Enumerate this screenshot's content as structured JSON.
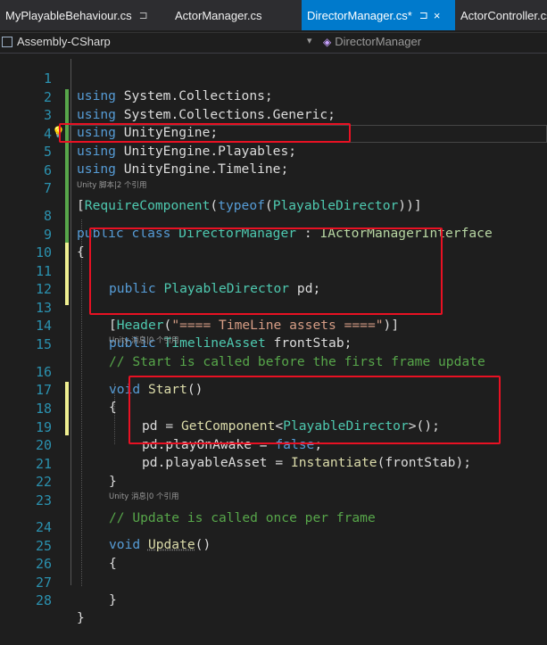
{
  "tabs": [
    {
      "label": "MyPlayableBehaviour.cs",
      "pin": "⊐"
    },
    {
      "label": "ActorManager.cs"
    },
    {
      "label": "DirectorManager.cs*",
      "pin": "⊐",
      "close": "×"
    },
    {
      "label": "ActorController.cs"
    }
  ],
  "navbar": {
    "project": "Assembly-CSharp",
    "dropdown": "▾",
    "class_name": "DirectorManager"
  },
  "lines": {
    "n1": "1",
    "n2": "2",
    "n3": "3",
    "n4": "4",
    "n5": "5",
    "n6": "6",
    "n7": "7",
    "n8": "8",
    "n9": "9",
    "n10": "10",
    "n11": "11",
    "n12": "12",
    "n13": "13",
    "n14": "14",
    "n15": "15",
    "n16": "16",
    "n17": "17",
    "n18": "18",
    "n19": "19",
    "n20": "20",
    "n21": "21",
    "n22": "22",
    "n23": "23",
    "n24": "24",
    "n25": "25",
    "n26": "26",
    "n27": "27",
    "n28": "28"
  },
  "code": {
    "using": "using",
    "ns1": "System.Collections;",
    "ns2": "System.Collections.Generic;",
    "ns3": "UnityEngine;",
    "ns4": "UnityEngine.Playables;",
    "ns5": "UnityEngine.Timeline;",
    "attr_open": "[",
    "attr_name": "RequireComponent",
    "attr_paren": "(",
    "typeof": "typeof",
    "attr_paren2": "(",
    "attr_type": "PlayableDirector",
    "attr_close": "))]",
    "public": "public",
    "class": "class",
    "class_name": "DirectorManager",
    "colon": ":",
    "iface": "IActorManagerInterface",
    "brace_open": "{",
    "brace_close": "}",
    "field1_type": "PlayableDirector",
    "field1_name": "pd;",
    "header_open": "[",
    "header_name": "Header",
    "header_paren": "(",
    "header_str": "\"==== TimeLine assets ====\"",
    "header_close": ")]",
    "field2_type": "TimelineAsset",
    "field2_name": "frontStab;",
    "comment1": "// Start is called before the first frame update",
    "void": "void",
    "start_fn": "Start",
    "parens": "()",
    "s1_a": "pd = ",
    "s1_fn": "GetComponent",
    "s1_lt": "<",
    "s1_type": "PlayableDirector",
    "s1_rest": ">();",
    "s2_a": "pd.playOnAwake = ",
    "s2_kw": "false",
    "s2_rest": ";",
    "s3_a": "pd.playableAsset = ",
    "s3_fn": "Instantiate",
    "s3_rest": "(frontStab);",
    "comment2": "// Update is called once per frame",
    "update_fn": "Update"
  },
  "hints": {
    "h1": "Unity 脚本|2 个引用",
    "h2": "Unity 消息|0 个引用",
    "h3": "Unity 消息|0 个引用"
  },
  "icons": {
    "bulb": "💡",
    "class_icon": "◈"
  },
  "colors": {
    "tab_active": "#007acc",
    "keyword": "#569cd6",
    "type": "#4ec9b0",
    "string": "#d69d85",
    "comment": "#57a64a",
    "method": "#dcdcaa",
    "line_number": "#2b91af",
    "highlight_box": "#e81123"
  }
}
